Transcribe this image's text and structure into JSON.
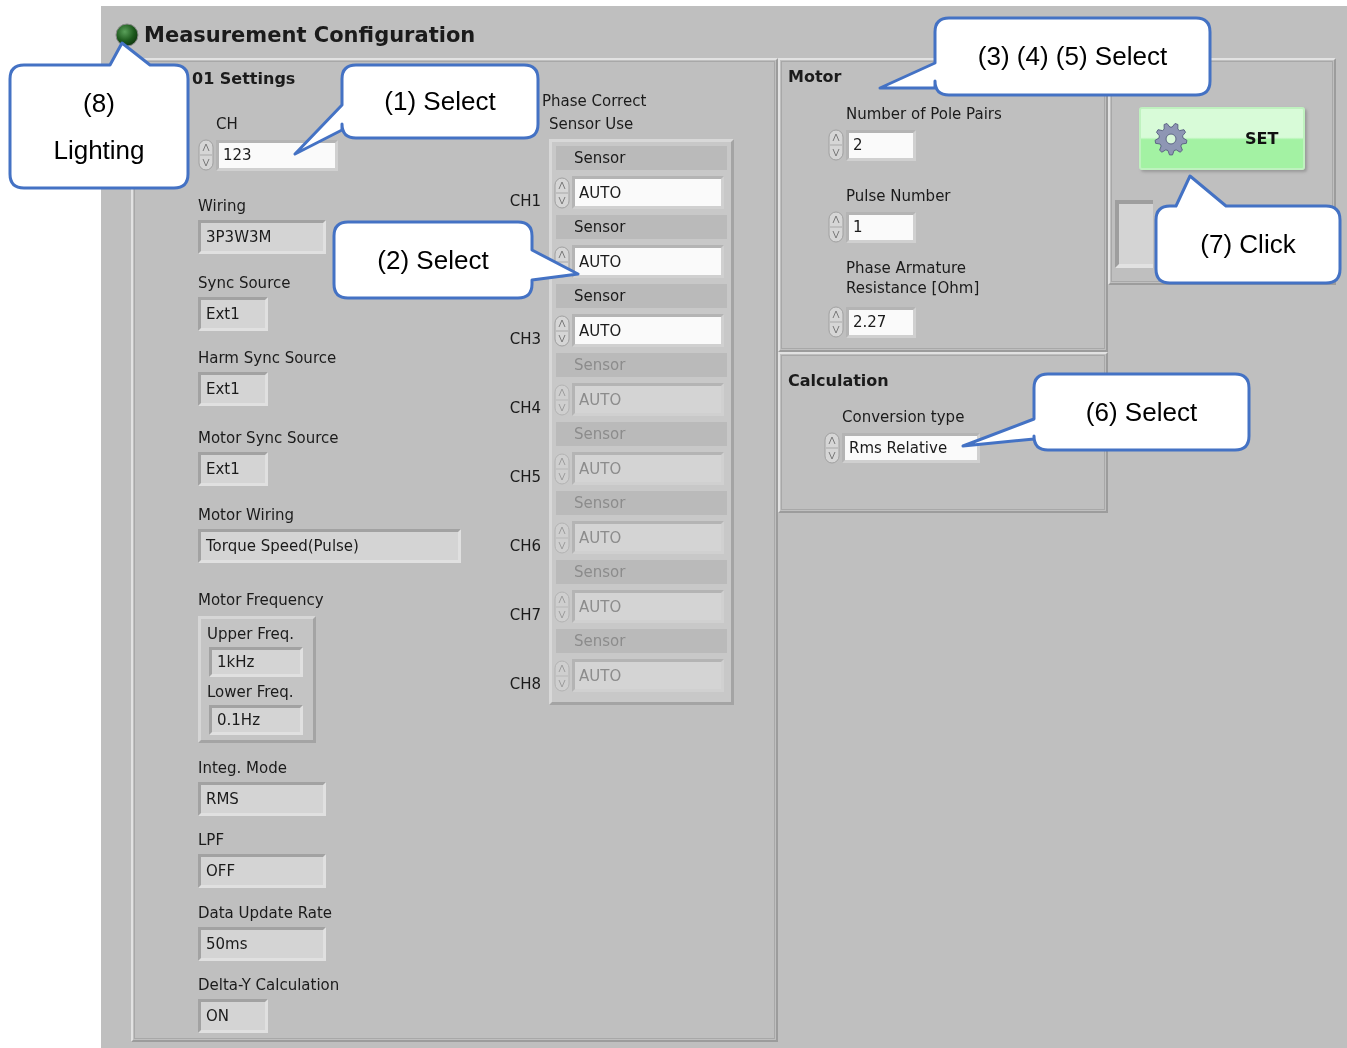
{
  "title": "Measurement Configuration",
  "settings": {
    "title": "01 Settings",
    "controls": [
      {
        "label": "CH",
        "value": "123",
        "kind": "numeric"
      },
      {
        "label": "Wiring",
        "value": "3P3W3M",
        "kind": "indicator"
      },
      {
        "label": "Sync Source",
        "value": "Ext1",
        "kind": "indicator"
      },
      {
        "label": "Harm Sync Source",
        "value": "Ext1",
        "kind": "indicator"
      },
      {
        "label": "Motor Sync Source",
        "value": "Ext1",
        "kind": "indicator"
      },
      {
        "label": "Motor Wiring",
        "value": "Torque Speed(Pulse)",
        "kind": "indicator"
      },
      {
        "label": "Motor Frequency",
        "kind": "group",
        "children": [
          {
            "label": "Upper Freq.",
            "value": "1kHz"
          },
          {
            "label": "Lower Freq.",
            "value": "0.1Hz"
          }
        ]
      },
      {
        "label": "Integ. Mode",
        "value": "RMS",
        "kind": "indicator"
      },
      {
        "label": "LPF",
        "value": "OFF",
        "kind": "indicator"
      },
      {
        "label": "Data Update Rate",
        "value": "50ms",
        "kind": "indicator"
      },
      {
        "label": "Delta-Y Calculation",
        "value": "ON",
        "kind": "indicator"
      }
    ]
  },
  "phase_correct": {
    "title": [
      "Phase Correct",
      "Sensor Use"
    ],
    "channels": [
      {
        "label": "CH1",
        "sensor_label": "Sensor",
        "value": "AUTO",
        "disabled": false
      },
      {
        "sensor_label": "Sensor",
        "value": "AUTO",
        "disabled": false
      },
      {
        "label": "CH3",
        "sensor_label": "Sensor",
        "value": "AUTO",
        "disabled": false
      },
      {
        "label": "CH4",
        "sensor_label": "Sensor",
        "value": "AUTO",
        "disabled": true
      },
      {
        "label": "CH5",
        "sensor_label": "Sensor",
        "value": "AUTO",
        "disabled": true
      },
      {
        "label": "CH6",
        "sensor_label": "Sensor",
        "value": "AUTO",
        "disabled": true
      },
      {
        "label": "CH7",
        "sensor_label": "Sensor",
        "value": "AUTO",
        "disabled": true
      },
      {
        "label": "CH8",
        "sensor_label": "Sensor",
        "value": "AUTO",
        "disabled": true
      }
    ]
  },
  "motor": {
    "title": "Motor",
    "controls": [
      {
        "label": "Number of Pole Pairs",
        "value": "2",
        "kind": "numeric"
      },
      {
        "label": "Pulse Number",
        "value": "1",
        "kind": "numeric"
      },
      {
        "label": "Phase Armature\nResistance [Ohm]",
        "value": "2.27",
        "kind": "numeric"
      }
    ]
  },
  "calculation": {
    "title": "Calculation",
    "controls": [
      {
        "label": "Conversion type",
        "value": "Rms Relative",
        "kind": "numeric"
      }
    ]
  },
  "set_button": {
    "label": "SET"
  },
  "callouts": [
    {
      "text": "(8)\nLighting"
    },
    {
      "text": "(1) Select"
    },
    {
      "text": "(3) (4) (5) Select"
    },
    {
      "text": "(7) Click"
    },
    {
      "text": "(2) Select"
    },
    {
      "text": "(6) Select"
    }
  ]
}
